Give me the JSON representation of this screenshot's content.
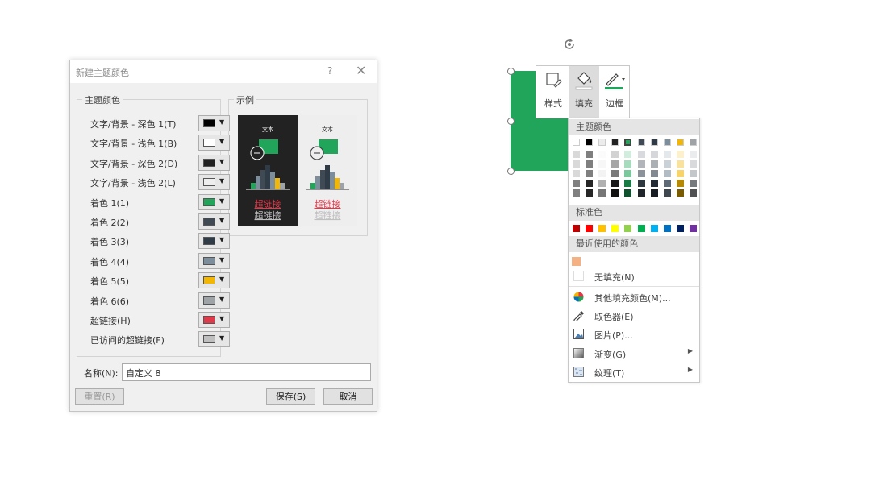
{
  "dialog": {
    "title": "新建主题颜色",
    "help": "?",
    "close": "✕",
    "theme_group": "主题颜色",
    "sample_group": "示例",
    "rows": [
      {
        "label": "文字/背景 - 深色 1(T)",
        "color": "#000000"
      },
      {
        "label": "文字/背景 - 浅色 1(B)",
        "color": "#ffffff"
      },
      {
        "label": "文字/背景 - 深色 2(D)",
        "color": "#222222"
      },
      {
        "label": "文字/背景 - 浅色 2(L)",
        "color": "#eeeeee"
      },
      {
        "label": "着色 1(1)",
        "color": "#21a55a"
      },
      {
        "label": "着色 2(2)",
        "color": "#3f4a55"
      },
      {
        "label": "着色 3(3)",
        "color": "#2f3b46"
      },
      {
        "label": "着色 4(4)",
        "color": "#7c8e9c"
      },
      {
        "label": "着色 5(5)",
        "color": "#f2b705"
      },
      {
        "label": "着色 6(6)",
        "color": "#9ea3a7"
      },
      {
        "label": "超链接(H)",
        "color": "#e03a4a"
      },
      {
        "label": "已访问的超链接(F)",
        "color": "#bfbfbf"
      }
    ],
    "sample": {
      "text": "文本",
      "link": "超链接",
      "visited": "超链接"
    },
    "name_label": "名称(N):",
    "name_value": "自定义 8",
    "reset": "重置(R)",
    "save": "保存(S)",
    "cancel": "取消"
  },
  "mini": {
    "style": "样式",
    "fill": "填充",
    "border": "边框"
  },
  "menu": {
    "theme_header": "主题颜色",
    "standard_header": "标准色",
    "recent_header": "最近使用的颜色",
    "theme_top": [
      "#ffffff",
      "#000000",
      "#ececec",
      "#222222",
      "#21a55a",
      "#3f4a55",
      "#2f3b46",
      "#7c8e9c",
      "#f2b705",
      "#9ea3a7"
    ],
    "standard": [
      "#c00000",
      "#ff0000",
      "#ffc000",
      "#ffff00",
      "#92d050",
      "#00b050",
      "#00b0f0",
      "#0070c0",
      "#002060",
      "#7030a0"
    ],
    "recent": [
      "#f4b183"
    ],
    "no_fill": "无填充(N)",
    "more": "其他填充颜色(M)...",
    "eyedropper": "取色器(E)",
    "picture": "图片(P)...",
    "gradient": "渐变(G)",
    "texture": "纹理(T)"
  }
}
